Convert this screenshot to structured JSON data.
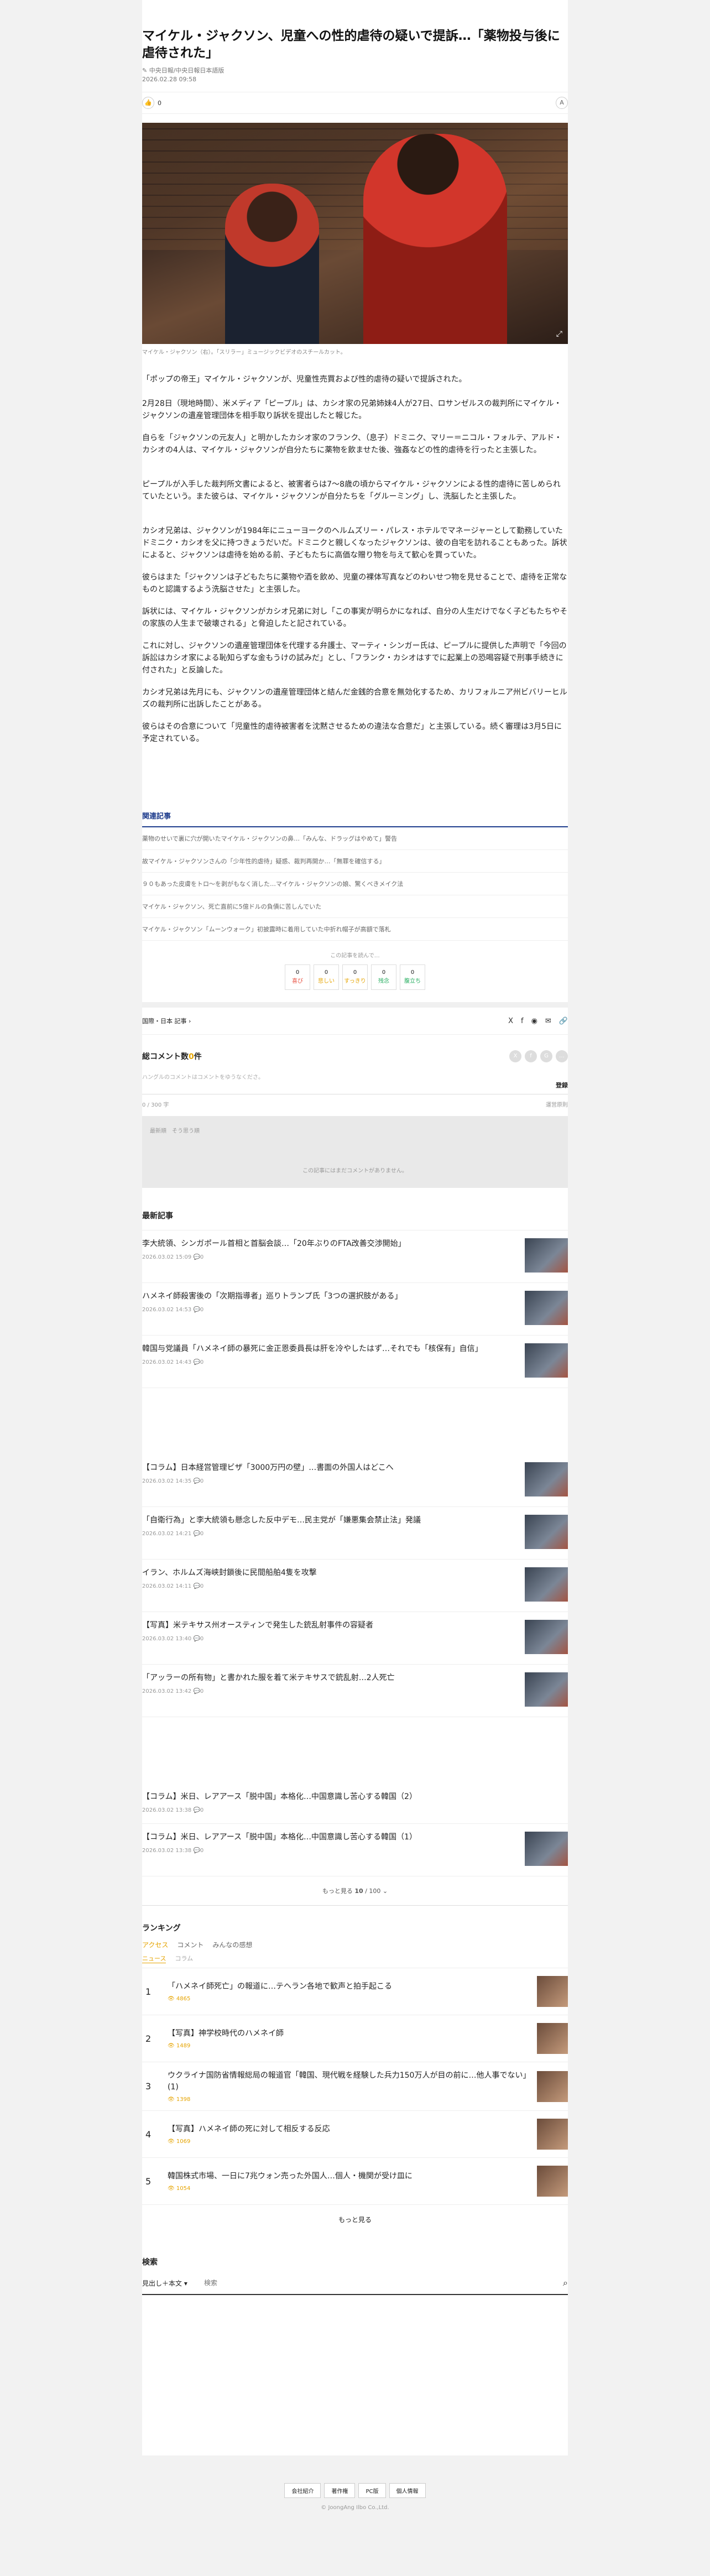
{
  "article": {
    "title": "マイケル・ジャクソン、児童への性的虐待の疑いで提訴…「薬物投与後に虐待された」",
    "byline": "中央日報/中央日報日本語版",
    "date": "2026.02.28 09:58",
    "like_count": "0",
    "font_btn": "A",
    "caption": "マイケル・ジャクソン（右）。「スリラー」ミュージックビデオのスチールカット。",
    "lead": "「ポップの帝王」マイケル・ジャクソンが、児童性売買および性的虐待の疑いで提訴された。",
    "paragraphs": [
      "2月28日（現地時間）、米メディア「ピープル」は、カシオ家の兄弟姉妹4人が27日、ロサンゼルスの裁判所にマイケル・ジャクソンの遺産管理団体を相手取り訴状を提出したと報じた。",
      "自らを「ジャクソンの元友人」と明かしたカシオ家のフランク、（息子）ドミニク、マリー＝ニコル・フォルテ、アルド・カシオの4人は、マイケル・ジャクソンが自分たちに薬物を飲ませた後、強姦などの性的虐待を行ったと主張した。",
      "ピープルが入手した裁判所文書によると、被害者らは7～8歳の頃からマイケル・ジャクソンによる性的虐待に苦しめられていたという。また彼らは、マイケル・ジャクソンが自分たちを「グルーミング」し、洗脳したと主張した。",
      "カシオ兄弟は、ジャクソンが1984年にニューヨークのヘルムズリー・パレス・ホテルでマネージャーとして勤務していたドミニク・カシオを父に持つきょうだいだ。ドミニクと親しくなったジャクソンは、彼の自宅を訪れることもあった。訴状によると、ジャクソンは虐待を始める前、子どもたちに高価な贈り物を与えて歓心を買っていた。",
      "彼らはまた「ジャクソンは子どもたちに薬物や酒を飲め、児童の裸体写真などのわいせつ物を見せることで、虐待を正常なものと認識するよう洗脳させた」と主張した。",
      "訴状には、マイケル・ジャクソンがカシオ兄弟に対し「この事実が明らかになれば、自分の人生だけでなく子どもたちやその家族の人生まで破壊される」と脅迫したと記されている。",
      "これに対し、ジャクソンの遺産管理団体を代理する弁護士、マーティ・シンガー氏は、ピープルに提供した声明で「今回の訴訟はカシオ家による恥知らずな金もうけの試みだ」とし、「フランク・カシオはすでに起業上の恐喝容疑で刑事手続きに付された」と反論した。",
      "カシオ兄弟は先月にも、ジャクソンの遺産管理団体と結んだ金銭的合意を無効化するため、カリフォルニア州ビバリーヒルズの裁判所に出訴したことがある。",
      "彼らはその合意について「児童性的虐待被害者を沈黙させるための違法な合意だ」と主張している。続く審理は3月5日に予定されている。"
    ]
  },
  "related": {
    "title": "関連記事",
    "items": [
      "薬物のせいで裏に穴が開いたマイケル・ジャクソンの鼻…「みんな、ドラッグはやめて」警告",
      "故マイケル・ジャクソンさんの「少年性的虐待」疑惑、裁判再開か…「無罪を確信する」",
      "９０もあった皮膚をトロ～を剥がもなく消した…マイケル・ジャクソンの娘、驚くべきメイク法",
      "マイケル・ジャクソン、死亡直前に5億ドルの負債に苦しんでいた",
      "マイケル・ジャクソン「ムーンウォーク」初披露時に着用していた中折れ帽子が高額で落札"
    ]
  },
  "reactions": {
    "label": "この記事を読んで…",
    "items": [
      {
        "label": "喜び",
        "count": "0"
      },
      {
        "label": "悲しい",
        "count": "0"
      },
      {
        "label": "すっきり",
        "count": "0"
      },
      {
        "label": "残念",
        "count": "0"
      },
      {
        "label": "腹立ち",
        "count": "0"
      }
    ]
  },
  "category": {
    "label": "国際・日本 記事",
    "share_icons": [
      "X",
      "f",
      "◉",
      "✉",
      "🔗"
    ]
  },
  "comments": {
    "title_prefix": "総コメント数",
    "count": "0",
    "title_suffix": "件",
    "note": "ハングルのコメントはコメントをゆうなくださ。",
    "register": "登録",
    "bar_left": "0 / 300 字",
    "bar_right": "運営原則",
    "tabs": "最新順　そう思う順",
    "empty": "この記事にはまだコメントがありません。"
  },
  "latest": {
    "title": "最新記事",
    "items": [
      {
        "title": "李大統領、シンガポール首相と首脳会談…「20年ぶりのFTA改善交渉開始」",
        "date": "2026.03.02 15:09",
        "comments": "0"
      },
      {
        "title": "ハメネイ師殺害後の「次期指導者」巡りトランプ氏「3つの選択肢がある」",
        "date": "2026.03.02 14:53",
        "comments": "0"
      },
      {
        "title": "韓国与党議員「ハメネイ師の暴死に金正恩委員長は肝を冷やしたはず…それでも「核保有」自信」",
        "date": "2026.03.02 14:43",
        "comments": "0"
      },
      {
        "title": "【コラム】日本経営管理ビザ「3000万円の壁」…書面の外国人はどこへ",
        "date": "2026.03.02 14:35",
        "comments": "0"
      },
      {
        "title": "「自衛行為」と李大統領も懸念した反中デモ…民主党が「嫌悪集会禁止法」発議",
        "date": "2026.03.02 14:21",
        "comments": "0"
      },
      {
        "title": "イラン、ホルムズ海峡封鎖後に民間船舶4隻を攻撃",
        "date": "2026.03.02 14:11",
        "comments": "0"
      },
      {
        "title": "【写真】米テキサス州オースティンで発生した銃乱射事件の容疑者",
        "date": "2026.03.02 13:40",
        "comments": "0"
      },
      {
        "title": "「アッラーの所有物」と書かれた服を着て米テキサスで銃乱射…2人死亡",
        "date": "2026.03.02 13:42",
        "comments": "0"
      },
      {
        "title": "【コラム】米日、レアアース「脱中国」本格化…中国意識し苦心する韓国（2）",
        "date": "2026.03.02 13:38",
        "comments": "0"
      },
      {
        "title": "【コラム】米日、レアアース「脱中国」本格化…中国意識し苦心する韓国（1）",
        "date": "2026.03.02 13:38",
        "comments": "0"
      }
    ],
    "more_prefix": "もっと見る",
    "more_count": "10",
    "more_total": "/ 100"
  },
  "ranking": {
    "title": "ランキング",
    "tabs": [
      "アクセス",
      "コメント",
      "みんなの感想"
    ],
    "subtabs": [
      "ニュース",
      "コラム"
    ],
    "items": [
      {
        "rank": "1",
        "title": "「ハメネイ師死亡」の報道に…テヘラン各地で歓声と拍手起こる",
        "views": "4865"
      },
      {
        "rank": "2",
        "title": "【写真】神学校時代のハメネイ師",
        "views": "1489"
      },
      {
        "rank": "3",
        "title": "ウクライナ国防省情報総局の報道官「韓国、現代戦を経験した兵力150万人が目の前に…他人事でない」(1)",
        "views": "1398"
      },
      {
        "rank": "4",
        "title": "【写真】ハメネイ師の死に対して相反する反応",
        "views": "1069"
      },
      {
        "rank": "5",
        "title": "韓国株式市場、一日に7兆ウォン売った外国人…個人・機関が受け皿に",
        "views": "1054"
      }
    ],
    "more": "もっと見る"
  },
  "search": {
    "title": "検索",
    "scope": "見出し＋本文",
    "placeholder": "検索"
  },
  "footer": {
    "links": [
      "会社紹介",
      "著作権",
      "PC版",
      "個人情報"
    ],
    "copyright": "© JoongAng Ilbo Co.,Ltd."
  }
}
